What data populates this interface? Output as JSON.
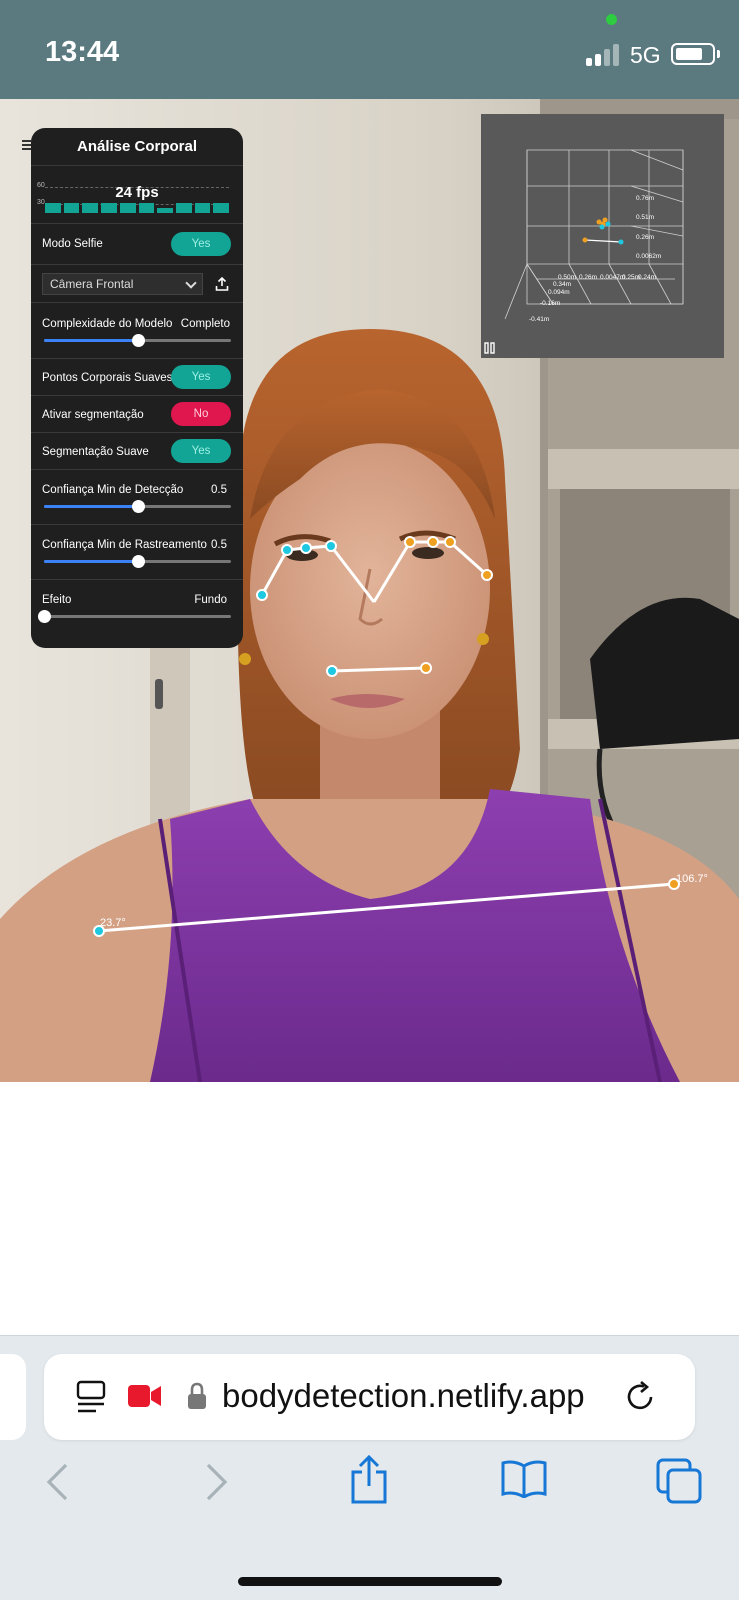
{
  "status_bar": {
    "time": "13:44",
    "network": "5G",
    "battery_level": 0.72,
    "signal_bars": 2,
    "signal_bars_total": 4,
    "camera_indicator_color": "#2ecc40"
  },
  "panel": {
    "title": "Análise Corporal",
    "fps": {
      "value_text": "24 fps",
      "scale_top": "60",
      "scale_mid": "30",
      "bar_color": "#12a495"
    },
    "selfie_mode": {
      "label": "Modo Selfie",
      "value": "Yes"
    },
    "camera_select": {
      "value": "Câmera Frontal"
    },
    "model_complexity": {
      "label": "Complexidade do Modelo",
      "value": "Completo",
      "level": 0.5
    },
    "smooth_landmarks": {
      "label": "Pontos Corporais Suaves",
      "value": "Yes"
    },
    "enable_segmentation": {
      "label": "Ativar segmentação",
      "value": "No"
    },
    "smooth_segmentation": {
      "label": "Segmentação Suave",
      "value": "Yes"
    },
    "min_detection_confidence": {
      "label": "Confiança Min de Detecção",
      "value": "0.5",
      "level": 0.5
    },
    "min_tracking_confidence": {
      "label": "Confiança Min de Rastreamento",
      "value": "0.5",
      "level": 0.5
    },
    "effect": {
      "label": "Efeito",
      "value": "Fundo",
      "level": 0.0
    },
    "accent_yes": "#12a495",
    "accent_no": "#e0174f",
    "slider_color": "#3b82f6"
  },
  "viewer_3d": {
    "axis_labels_right": [
      "0.76m",
      "0.51m",
      "0.26m",
      "0.0062m"
    ],
    "axis_labels_bottom": [
      "0.50m",
      "0.26m",
      "0.0047m",
      "0.25m",
      "0.24m"
    ],
    "axis_labels_depth": [
      "0.34m",
      "0.094m",
      "-0.16m",
      "-0.41m"
    ]
  },
  "pose_overlay": {
    "left_color": "#1ec8e0",
    "right_color": "#f0a020",
    "angle_left": "23.7°",
    "angle_right": "106.7°"
  },
  "browser": {
    "url": "bodydetection.netlify.app",
    "record_icon_color": "#e8192c",
    "icons": [
      "reader-icon",
      "video-camera-icon",
      "lock-icon",
      "reload-icon",
      "back-icon",
      "forward-icon",
      "share-icon",
      "bookmarks-icon",
      "tabs-icon"
    ]
  }
}
